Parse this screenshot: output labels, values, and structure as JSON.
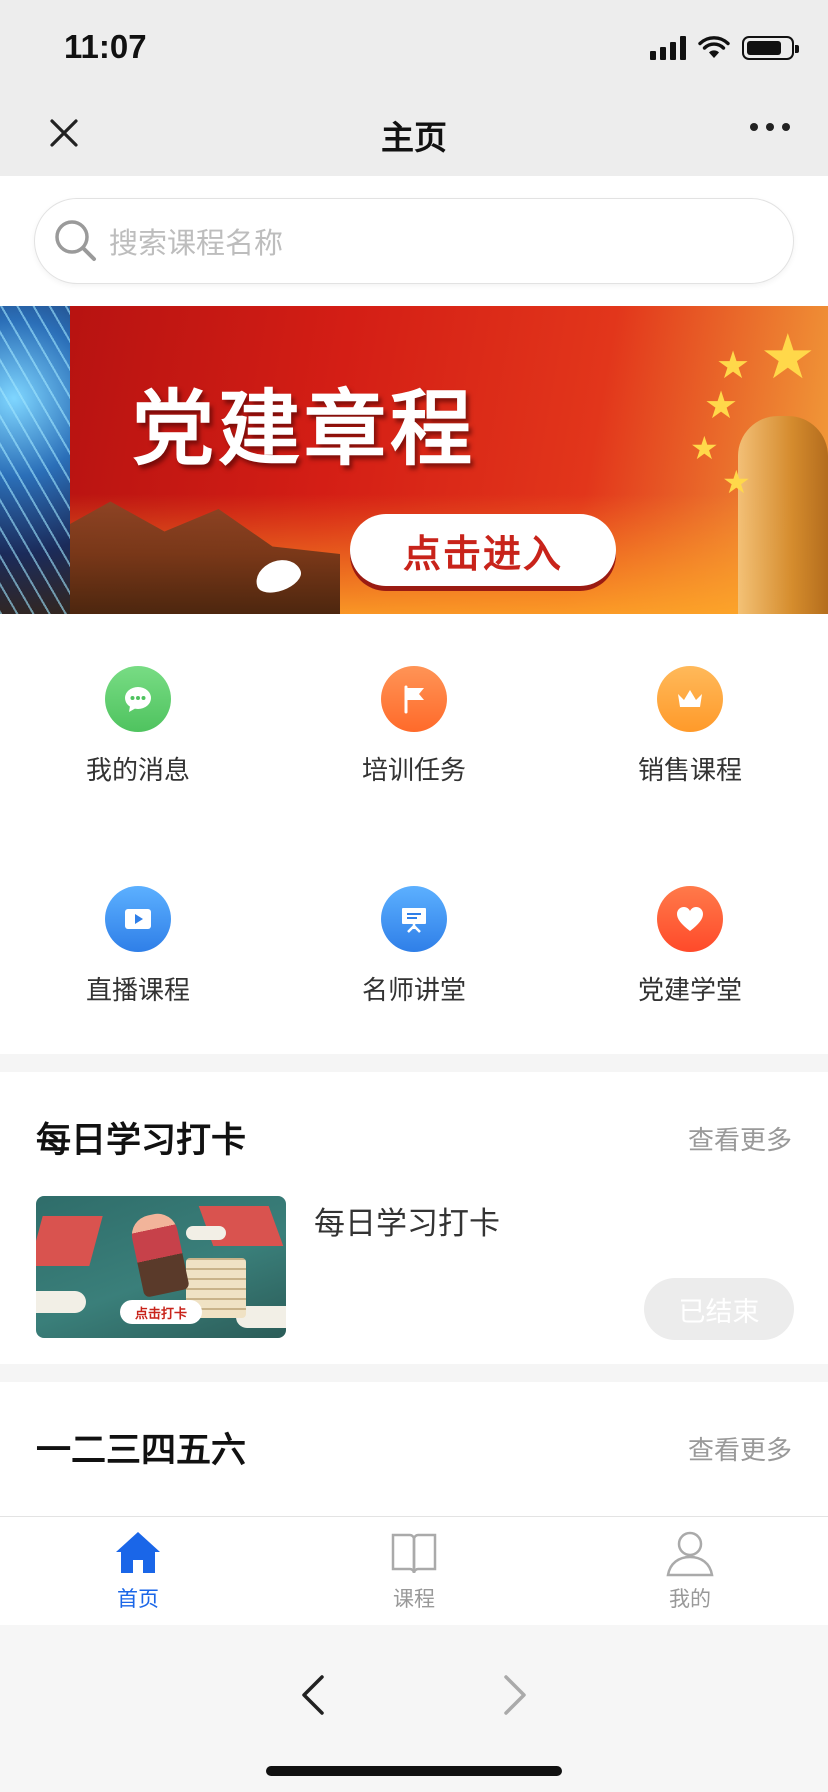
{
  "status_bar": {
    "time": "11:07"
  },
  "nav": {
    "title": "主页"
  },
  "search": {
    "placeholder": "搜索课程名称"
  },
  "banner": {
    "headline": "党建章程",
    "cta": "点击进入"
  },
  "grid": [
    {
      "label": "我的消息",
      "icon": "chat-bubble-icon",
      "color": "#5fcf6e"
    },
    {
      "label": "培训任务",
      "icon": "flag-icon",
      "color": "#ff7a3a"
    },
    {
      "label": "销售课程",
      "icon": "crown-icon",
      "color": "#ffa23a"
    },
    {
      "label": "直播课程",
      "icon": "play-icon",
      "color": "#3d8ff0"
    },
    {
      "label": "名师讲堂",
      "icon": "presentation-icon",
      "color": "#3d8ff0"
    },
    {
      "label": "党建学堂",
      "icon": "heart-icon",
      "color": "#ff5a3a"
    }
  ],
  "daily": {
    "title": "每日学习打卡",
    "more": "查看更多",
    "item_title": "每日学习打卡",
    "thumb_tag": "点击打卡",
    "status": "已结束"
  },
  "section2": {
    "title": "一二三四五六",
    "more": "查看更多"
  },
  "tabbar": [
    {
      "label": "首页",
      "icon": "home-icon",
      "active": true
    },
    {
      "label": "课程",
      "icon": "book-icon",
      "active": false
    },
    {
      "label": "我的",
      "icon": "user-icon",
      "active": false
    }
  ],
  "colors": {
    "accent": "#1a66e8",
    "muted": "#999999"
  }
}
